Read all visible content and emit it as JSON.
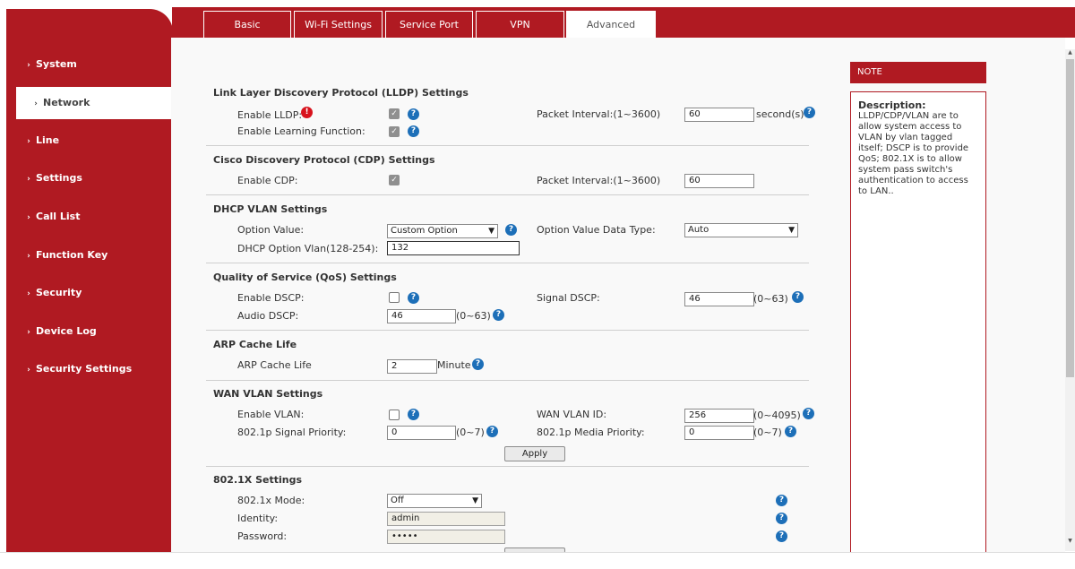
{
  "tabs": [
    {
      "label": "Basic"
    },
    {
      "label": "Wi-Fi Settings"
    },
    {
      "label": "Service Port"
    },
    {
      "label": "VPN"
    },
    {
      "label": "Advanced"
    }
  ],
  "sidebar": {
    "items": [
      {
        "label": "System"
      },
      {
        "label": "Network"
      },
      {
        "label": "Line"
      },
      {
        "label": "Settings"
      },
      {
        "label": "Call List"
      },
      {
        "label": "Function Key"
      },
      {
        "label": "Security"
      },
      {
        "label": "Device Log"
      },
      {
        "label": "Security Settings"
      }
    ],
    "active": "Network"
  },
  "lldp": {
    "title": "Link Layer Discovery Protocol (LLDP) Settings",
    "enable_label": "Enable LLDP:",
    "enable_checked": true,
    "learning_label": "Enable Learning Function:",
    "learning_checked": true,
    "interval_label": "Packet Interval:(1~3600)",
    "interval_value": "60",
    "interval_unit": "second(s)"
  },
  "cdp": {
    "title": "Cisco Discovery Protocol (CDP) Settings",
    "enable_label": "Enable CDP:",
    "enable_checked": true,
    "interval_label": "Packet Interval:(1~3600)",
    "interval_value": "60"
  },
  "dhcp_vlan": {
    "title": "DHCP VLAN Settings",
    "option_label": "Option Value:",
    "option_value": "Custom Option",
    "datatype_label": "Option Value Data Type:",
    "datatype_value": "Auto",
    "vlan_label": "DHCP Option Vlan(128-254):",
    "vlan_value": "132"
  },
  "qos": {
    "title": "Quality of Service (QoS) Settings",
    "dscp_label": "Enable DSCP:",
    "dscp_checked": false,
    "signal_label": "Signal DSCP:",
    "signal_value": "46",
    "signal_range": "(0~63)",
    "audio_label": "Audio DSCP:",
    "audio_value": "46",
    "audio_range": "(0~63)"
  },
  "arp": {
    "title": "ARP Cache Life",
    "label": "ARP Cache Life",
    "value": "2",
    "unit": "Minute"
  },
  "wan_vlan": {
    "title": "WAN VLAN Settings",
    "enable_label": "Enable VLAN:",
    "enable_checked": false,
    "id_label": "WAN VLAN ID:",
    "id_value": "256",
    "id_range": "(0~4095)",
    "signal_label": "802.1p Signal Priority:",
    "signal_value": "0",
    "signal_range": "(0~7)",
    "media_label": "802.1p Media Priority:",
    "media_value": "0",
    "media_range": "(0~7)",
    "apply_label": "Apply"
  },
  "dot1x": {
    "title": "802.1X Settings",
    "mode_label": "802.1x Mode:",
    "mode_value": "Off",
    "identity_label": "Identity:",
    "identity_value": "admin",
    "password_label": "Password:",
    "password_value": "•••••"
  },
  "note": {
    "header": "NOTE",
    "title": "Description:",
    "text": "LLDP/CDP/VLAN are to allow system access to VLAN by vlan tagged itself; DSCP is to provide QoS; 802.1X is to allow system pass switch's authentication to access to LAN.."
  },
  "icons": {
    "help": "question-circle-icon",
    "warn": "exclamation-circle-icon",
    "chevron": "chevron-right-icon"
  },
  "colors": {
    "brand": "#b01a22",
    "help": "#1d6fb8",
    "warn": "#d8131d"
  }
}
